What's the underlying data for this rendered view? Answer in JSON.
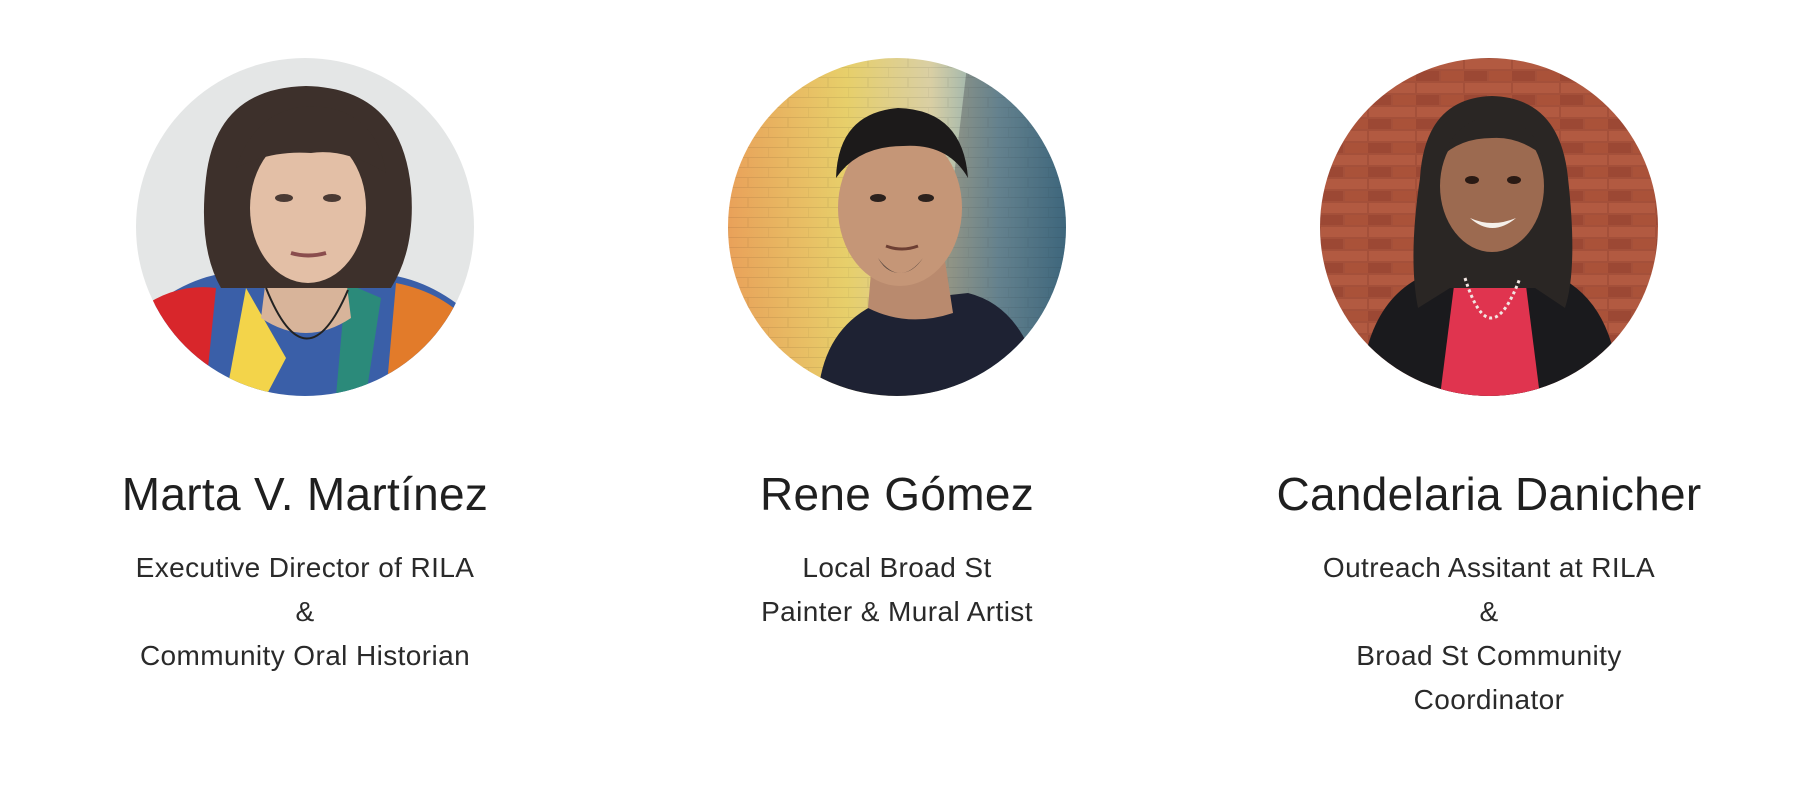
{
  "members": [
    {
      "name": "Marta V. Martínez",
      "role_lines": [
        "Executive Director of RILA",
        "&",
        "Community Oral Historian"
      ]
    },
    {
      "name": "Rene Gómez",
      "role_lines": [
        "Local Broad St",
        "Painter & Mural Artist"
      ]
    },
    {
      "name": "Candelaria Danicher",
      "role_lines": [
        "Outreach Assitant at RILA",
        "&",
        "Broad St Community",
        "Coordinator"
      ]
    }
  ]
}
